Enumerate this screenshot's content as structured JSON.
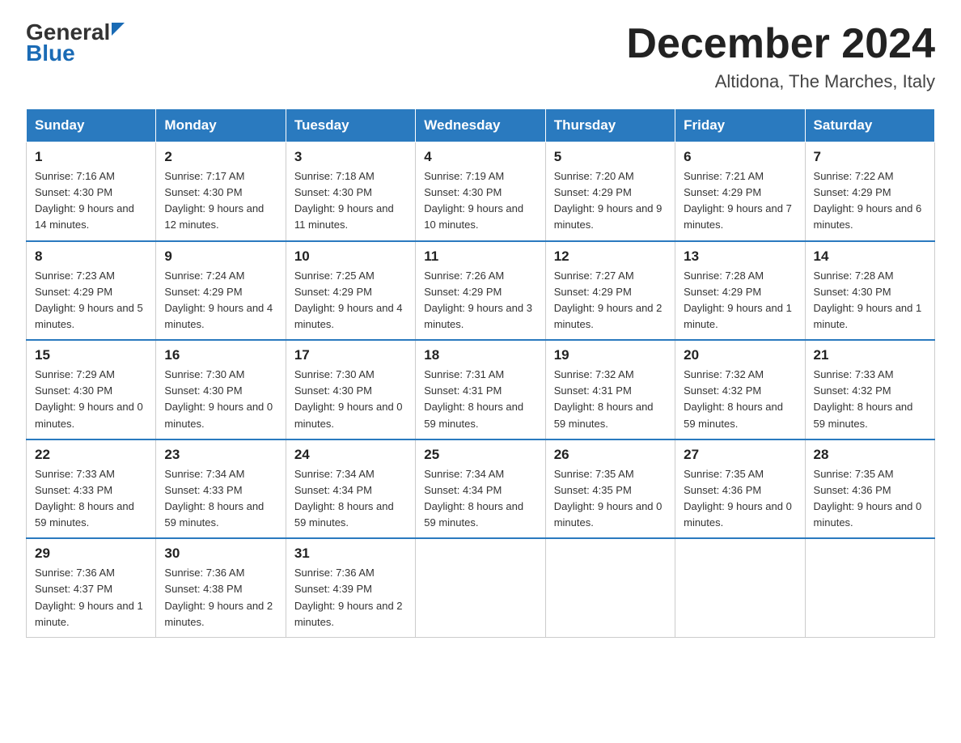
{
  "header": {
    "logo_general": "General",
    "logo_blue": "Blue",
    "month_title": "December 2024",
    "location": "Altidona, The Marches, Italy"
  },
  "days_of_week": [
    "Sunday",
    "Monday",
    "Tuesday",
    "Wednesday",
    "Thursday",
    "Friday",
    "Saturday"
  ],
  "weeks": [
    [
      {
        "day": "1",
        "sunrise": "7:16 AM",
        "sunset": "4:30 PM",
        "daylight": "9 hours and 14 minutes."
      },
      {
        "day": "2",
        "sunrise": "7:17 AM",
        "sunset": "4:30 PM",
        "daylight": "9 hours and 12 minutes."
      },
      {
        "day": "3",
        "sunrise": "7:18 AM",
        "sunset": "4:30 PM",
        "daylight": "9 hours and 11 minutes."
      },
      {
        "day": "4",
        "sunrise": "7:19 AM",
        "sunset": "4:30 PM",
        "daylight": "9 hours and 10 minutes."
      },
      {
        "day": "5",
        "sunrise": "7:20 AM",
        "sunset": "4:29 PM",
        "daylight": "9 hours and 9 minutes."
      },
      {
        "day": "6",
        "sunrise": "7:21 AM",
        "sunset": "4:29 PM",
        "daylight": "9 hours and 7 minutes."
      },
      {
        "day": "7",
        "sunrise": "7:22 AM",
        "sunset": "4:29 PM",
        "daylight": "9 hours and 6 minutes."
      }
    ],
    [
      {
        "day": "8",
        "sunrise": "7:23 AM",
        "sunset": "4:29 PM",
        "daylight": "9 hours and 5 minutes."
      },
      {
        "day": "9",
        "sunrise": "7:24 AM",
        "sunset": "4:29 PM",
        "daylight": "9 hours and 4 minutes."
      },
      {
        "day": "10",
        "sunrise": "7:25 AM",
        "sunset": "4:29 PM",
        "daylight": "9 hours and 4 minutes."
      },
      {
        "day": "11",
        "sunrise": "7:26 AM",
        "sunset": "4:29 PM",
        "daylight": "9 hours and 3 minutes."
      },
      {
        "day": "12",
        "sunrise": "7:27 AM",
        "sunset": "4:29 PM",
        "daylight": "9 hours and 2 minutes."
      },
      {
        "day": "13",
        "sunrise": "7:28 AM",
        "sunset": "4:29 PM",
        "daylight": "9 hours and 1 minute."
      },
      {
        "day": "14",
        "sunrise": "7:28 AM",
        "sunset": "4:30 PM",
        "daylight": "9 hours and 1 minute."
      }
    ],
    [
      {
        "day": "15",
        "sunrise": "7:29 AM",
        "sunset": "4:30 PM",
        "daylight": "9 hours and 0 minutes."
      },
      {
        "day": "16",
        "sunrise": "7:30 AM",
        "sunset": "4:30 PM",
        "daylight": "9 hours and 0 minutes."
      },
      {
        "day": "17",
        "sunrise": "7:30 AM",
        "sunset": "4:30 PM",
        "daylight": "9 hours and 0 minutes."
      },
      {
        "day": "18",
        "sunrise": "7:31 AM",
        "sunset": "4:31 PM",
        "daylight": "8 hours and 59 minutes."
      },
      {
        "day": "19",
        "sunrise": "7:32 AM",
        "sunset": "4:31 PM",
        "daylight": "8 hours and 59 minutes."
      },
      {
        "day": "20",
        "sunrise": "7:32 AM",
        "sunset": "4:32 PM",
        "daylight": "8 hours and 59 minutes."
      },
      {
        "day": "21",
        "sunrise": "7:33 AM",
        "sunset": "4:32 PM",
        "daylight": "8 hours and 59 minutes."
      }
    ],
    [
      {
        "day": "22",
        "sunrise": "7:33 AM",
        "sunset": "4:33 PM",
        "daylight": "8 hours and 59 minutes."
      },
      {
        "day": "23",
        "sunrise": "7:34 AM",
        "sunset": "4:33 PM",
        "daylight": "8 hours and 59 minutes."
      },
      {
        "day": "24",
        "sunrise": "7:34 AM",
        "sunset": "4:34 PM",
        "daylight": "8 hours and 59 minutes."
      },
      {
        "day": "25",
        "sunrise": "7:34 AM",
        "sunset": "4:34 PM",
        "daylight": "8 hours and 59 minutes."
      },
      {
        "day": "26",
        "sunrise": "7:35 AM",
        "sunset": "4:35 PM",
        "daylight": "9 hours and 0 minutes."
      },
      {
        "day": "27",
        "sunrise": "7:35 AM",
        "sunset": "4:36 PM",
        "daylight": "9 hours and 0 minutes."
      },
      {
        "day": "28",
        "sunrise": "7:35 AM",
        "sunset": "4:36 PM",
        "daylight": "9 hours and 0 minutes."
      }
    ],
    [
      {
        "day": "29",
        "sunrise": "7:36 AM",
        "sunset": "4:37 PM",
        "daylight": "9 hours and 1 minute."
      },
      {
        "day": "30",
        "sunrise": "7:36 AM",
        "sunset": "4:38 PM",
        "daylight": "9 hours and 2 minutes."
      },
      {
        "day": "31",
        "sunrise": "7:36 AM",
        "sunset": "4:39 PM",
        "daylight": "9 hours and 2 minutes."
      },
      null,
      null,
      null,
      null
    ]
  ],
  "labels": {
    "sunrise": "Sunrise:",
    "sunset": "Sunset:",
    "daylight": "Daylight:"
  }
}
